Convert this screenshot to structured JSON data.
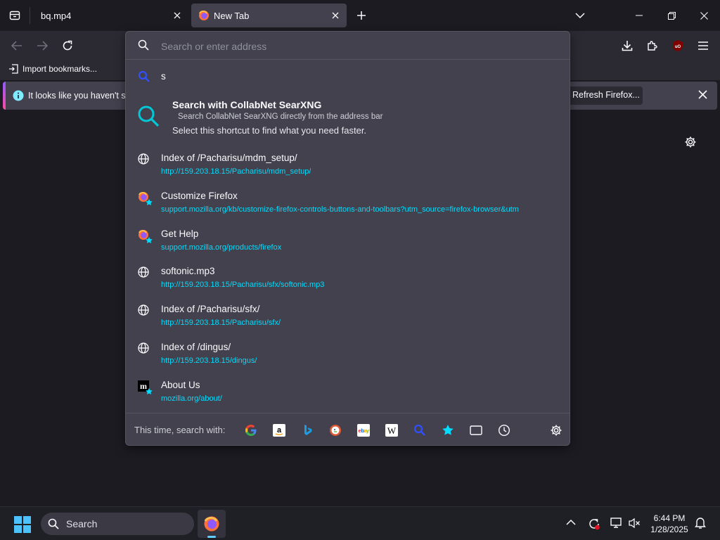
{
  "tabs": [
    {
      "title": "bq.mp4",
      "active": false
    },
    {
      "title": "New Tab",
      "active": true
    }
  ],
  "bookmarks": {
    "import_label": "Import bookmarks..."
  },
  "notification": {
    "text": "It looks like you haven't st",
    "button": "Refresh Firefox..."
  },
  "urlbar": {
    "placeholder": "Search or enter address",
    "typed": "s",
    "shortcut": {
      "title": "Search with CollabNet SearXNG",
      "subtitle": "Search CollabNet SearXNG directly from the address bar",
      "hint": "Select this shortcut to find what you need faster."
    },
    "results": [
      {
        "icon": "globe-icon",
        "title": "Index of /Pacharisu/mdm_setup/",
        "url": "http://159.203.18.15/Pacharisu/mdm_setup/"
      },
      {
        "icon": "firefox-star-icon",
        "title": "Customize Firefox",
        "url": "support.mozilla.org/kb/customize-firefox-controls-buttons-and-toolbars?utm_source=firefox-browser&utm"
      },
      {
        "icon": "firefox-star-icon",
        "title": "Get Help",
        "url": "support.mozilla.org/products/firefox"
      },
      {
        "icon": "globe-icon",
        "title": "softonic.mp3",
        "url": "http://159.203.18.15/Pacharisu/sfx/softonic.mp3"
      },
      {
        "icon": "globe-icon",
        "title": "Index of /Pacharisu/sfx/",
        "url": "http://159.203.18.15/Pacharisu/sfx/"
      },
      {
        "icon": "globe-icon",
        "title": "Index of /dingus/",
        "url": "http://159.203.18.15/dingus/"
      },
      {
        "icon": "mozilla-m-icon",
        "title": "About Us",
        "url": "mozilla.org/about/"
      }
    ],
    "footer_label": "This time, search with:",
    "engines": [
      "google-icon",
      "amazon-icon",
      "bing-icon",
      "duckduckgo-icon",
      "ebay-icon",
      "wikipedia-icon",
      "searxng-icon",
      "bookmarks-star-icon",
      "tabs-icon",
      "history-icon"
    ]
  },
  "taskbar": {
    "search_label": "Search",
    "time": "6:44 PM",
    "date": "1/28/2025"
  },
  "colors": {
    "accent": "#00ddff",
    "panel": "#42414d",
    "toolbar": "#2b2a33",
    "background": "#1c1b22"
  }
}
